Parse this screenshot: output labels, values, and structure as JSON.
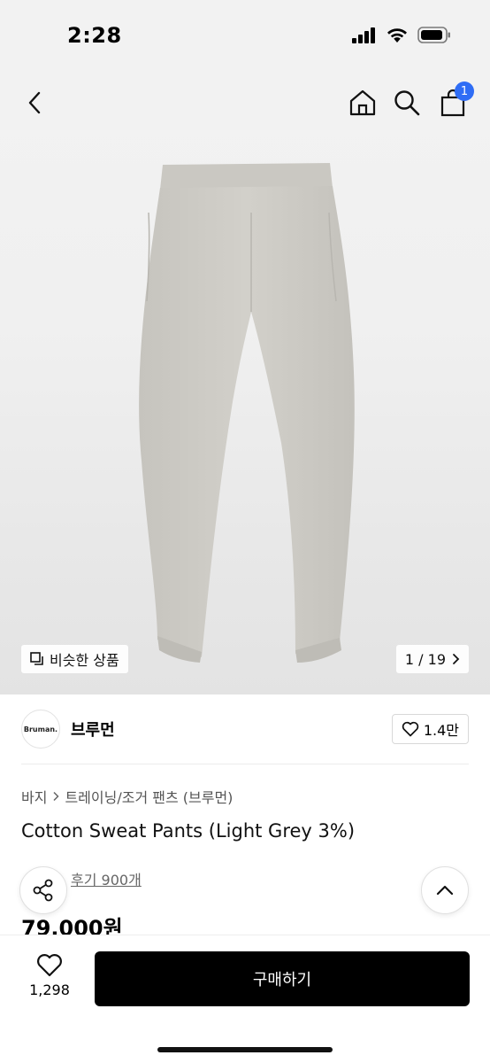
{
  "status_bar": {
    "time": "2:28"
  },
  "header": {
    "cart_count": "1"
  },
  "gallery": {
    "similar_label": "비슷한 상품",
    "pager": "1 / 19"
  },
  "brand": {
    "logo_text": "Bruman.",
    "name": "브루먼",
    "likes": "1.4만"
  },
  "breadcrumb": {
    "level1": "바지",
    "level2": "트레이닝/조거 팬츠 (브루먼)"
  },
  "product": {
    "title": "Cotton Sweat Pants (Light Grey 3%)",
    "review_label": "후기 900개",
    "price": "79,000원"
  },
  "bottom": {
    "wish_count": "1,298",
    "buy_label": "구매하기"
  },
  "colors": {
    "badge": "#2f6df5",
    "buy_button": "#000000",
    "pants": "#cfcdc7"
  }
}
